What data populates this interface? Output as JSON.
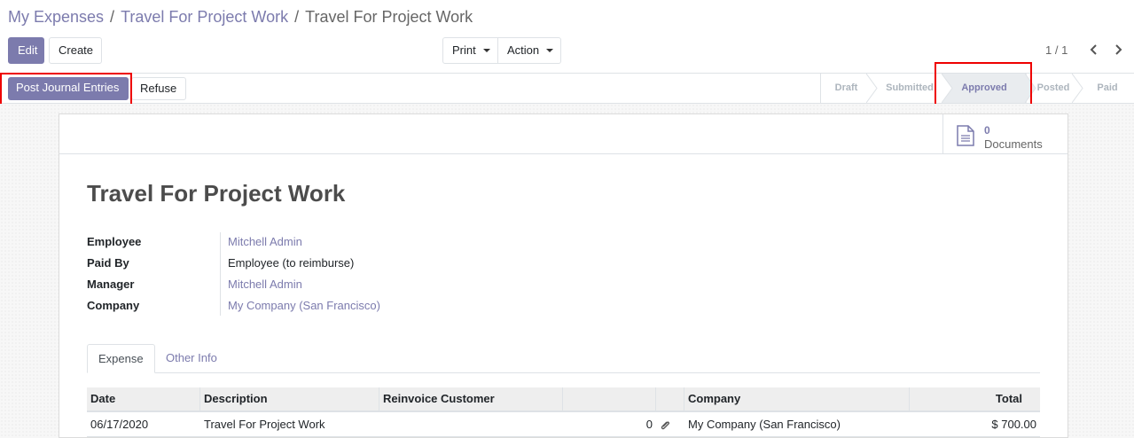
{
  "breadcrumb": {
    "items": [
      "My Expenses",
      "Travel For Project Work"
    ],
    "separator": "/",
    "current": "Travel For Project Work"
  },
  "toolbar": {
    "edit_label": "Edit",
    "create_label": "Create",
    "print_label": "Print",
    "action_label": "Action"
  },
  "pager": {
    "value": "1 / 1",
    "prev_icon": "chevron-left-icon",
    "next_icon": "chevron-right-icon"
  },
  "statusbar": {
    "post_label": "Post Journal Entries",
    "refuse_label": "Refuse",
    "stages": [
      "Draft",
      "Submitted",
      "Approved",
      "Posted",
      "Paid"
    ],
    "current_stage": "Approved"
  },
  "documents": {
    "count": "0",
    "label": "Documents",
    "icon": "document-icon"
  },
  "form": {
    "title": "Travel For Project Work",
    "fields": [
      {
        "label": "Employee",
        "value": "Mitchell Admin"
      },
      {
        "label": "Paid By",
        "value": "Employee (to reimburse)"
      },
      {
        "label": "Manager",
        "value": "Mitchell Admin"
      },
      {
        "label": "Company",
        "value": "My Company (San Francisco)"
      }
    ]
  },
  "tabs": [
    "Expense",
    "Other Info"
  ],
  "table": {
    "headers": [
      "Date",
      "Description",
      "Reinvoice Customer",
      "",
      "",
      "Company",
      "Total"
    ],
    "rows": [
      {
        "date": "06/17/2020",
        "description": "Travel For Project Work",
        "reinvoice_customer": "",
        "attachments": "0",
        "attachment_icon": "paperclip-icon",
        "company": "My Company (San Francisco)",
        "total": "$ 700.00"
      }
    ]
  },
  "colors": {
    "primary": "#7c7bad",
    "highlight": "#e00000"
  }
}
